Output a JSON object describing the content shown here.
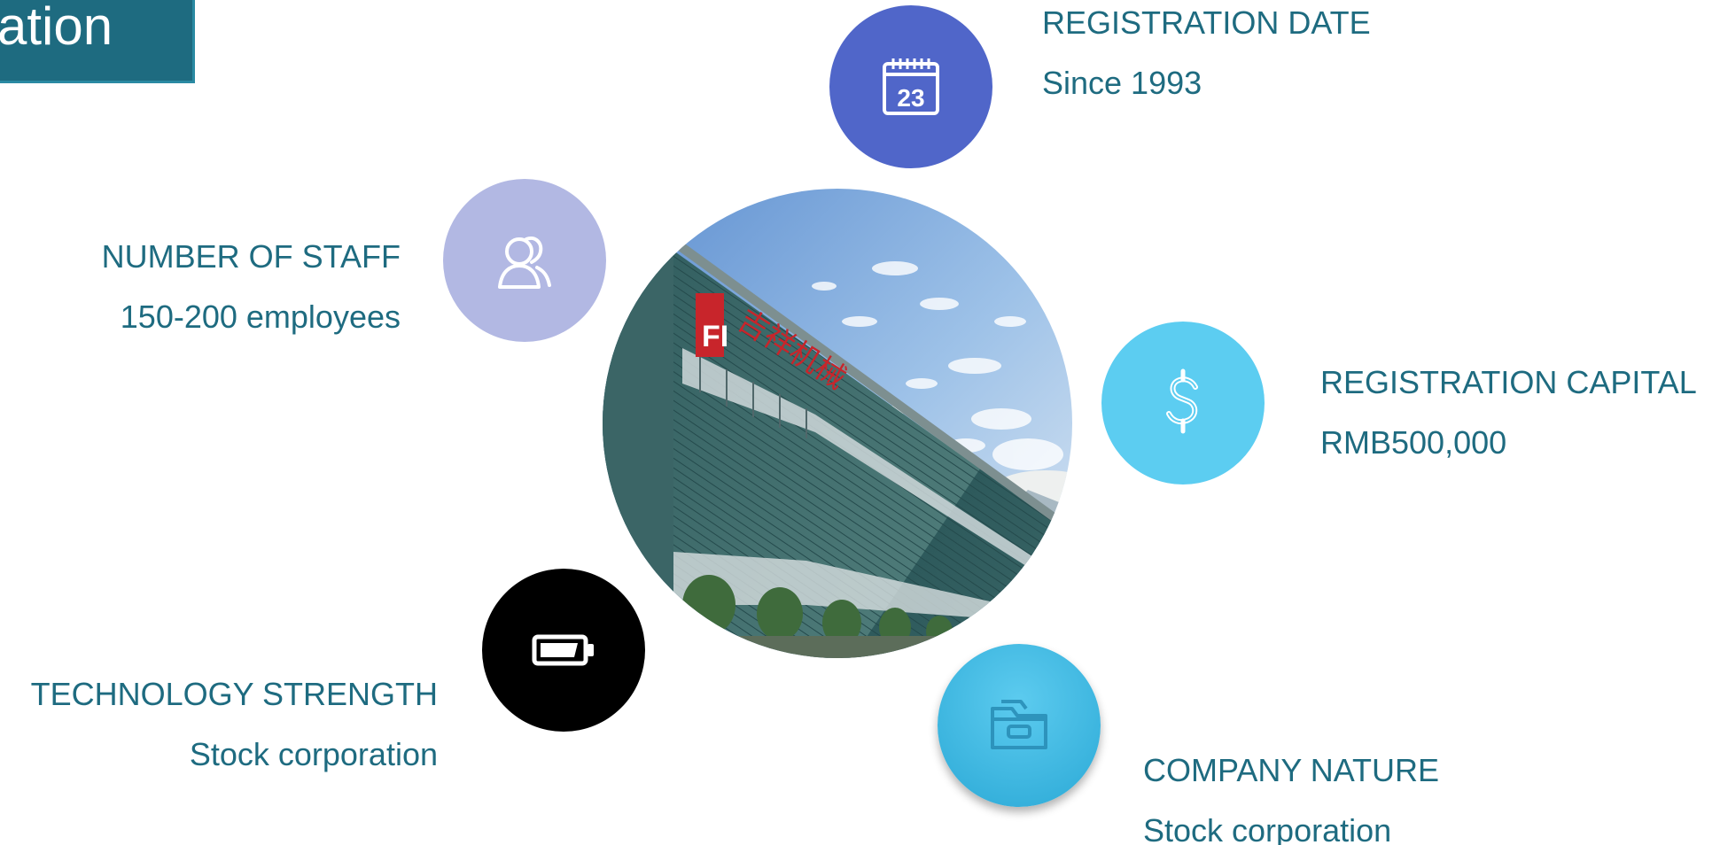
{
  "slide": {
    "title": "ation"
  },
  "items": {
    "registration_date": {
      "label": "REGISTRATION DATE",
      "value": "Since 1993",
      "icon": "calendar-icon",
      "calendar_day": "23",
      "color": "#5066c9"
    },
    "number_of_staff": {
      "label": "NUMBER OF STAFF",
      "value": "150-200 employees",
      "icon": "user-icon",
      "color": "#b2b8e3"
    },
    "registration_capital": {
      "label": "REGISTRATION CAPITAL",
      "value": "RMB500,000",
      "icon": "dollar-icon",
      "color": "#5ccdf1"
    },
    "technology_strength": {
      "label": "TECHNOLOGY STRENGTH",
      "value": "Stock corporation",
      "icon": "battery-icon",
      "color": "#000000"
    },
    "company_nature": {
      "label": "COMPANY NATURE",
      "value": "Stock corporation",
      "icon": "folder-icon",
      "color": "#3bb8e3"
    }
  },
  "photo": {
    "icon": "factory-building-photo",
    "sign_logo": "FI",
    "sign_text": "吉祥机械"
  },
  "colors": {
    "accent": "#1e6b80",
    "text": "#1e6b80"
  }
}
